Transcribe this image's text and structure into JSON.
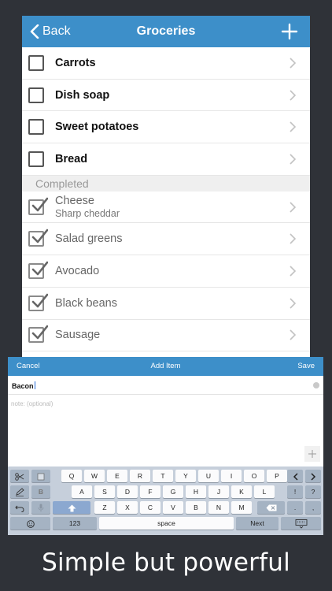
{
  "navbar": {
    "back_label": "Back",
    "title": "Groceries"
  },
  "active_items": [
    {
      "label": "Carrots"
    },
    {
      "label": "Dish soap"
    },
    {
      "label": "Sweet potatoes"
    },
    {
      "label": "Bread"
    }
  ],
  "completed_section_label": "Completed",
  "completed_items": [
    {
      "label": "Cheese",
      "note": "Sharp cheddar"
    },
    {
      "label": "Salad greens"
    },
    {
      "label": "Avocado"
    },
    {
      "label": "Black beans"
    },
    {
      "label": "Sausage"
    }
  ],
  "add_item": {
    "cancel_label": "Cancel",
    "title": "Add Item",
    "save_label": "Save",
    "item_value": "Bacon",
    "note_placeholder": "note: (optional)"
  },
  "keyboard": {
    "row1": [
      "Q",
      "W",
      "E",
      "R",
      "T",
      "Y",
      "U",
      "I",
      "O",
      "P"
    ],
    "row2": [
      "A",
      "S",
      "D",
      "F",
      "G",
      "H",
      "J",
      "K",
      "L"
    ],
    "row3": [
      "Z",
      "X",
      "C",
      "V",
      "B",
      "N",
      "M"
    ],
    "row2_right": "!",
    "row2_right2": "?",
    "row3_right": ".",
    "row3_right2": ",",
    "numbers_label": "123",
    "space_label": "space",
    "next_label": "Next"
  },
  "tagline": "Simple but powerful",
  "colors": {
    "accent": "#3d8fc9",
    "background": "#2f3238"
  }
}
